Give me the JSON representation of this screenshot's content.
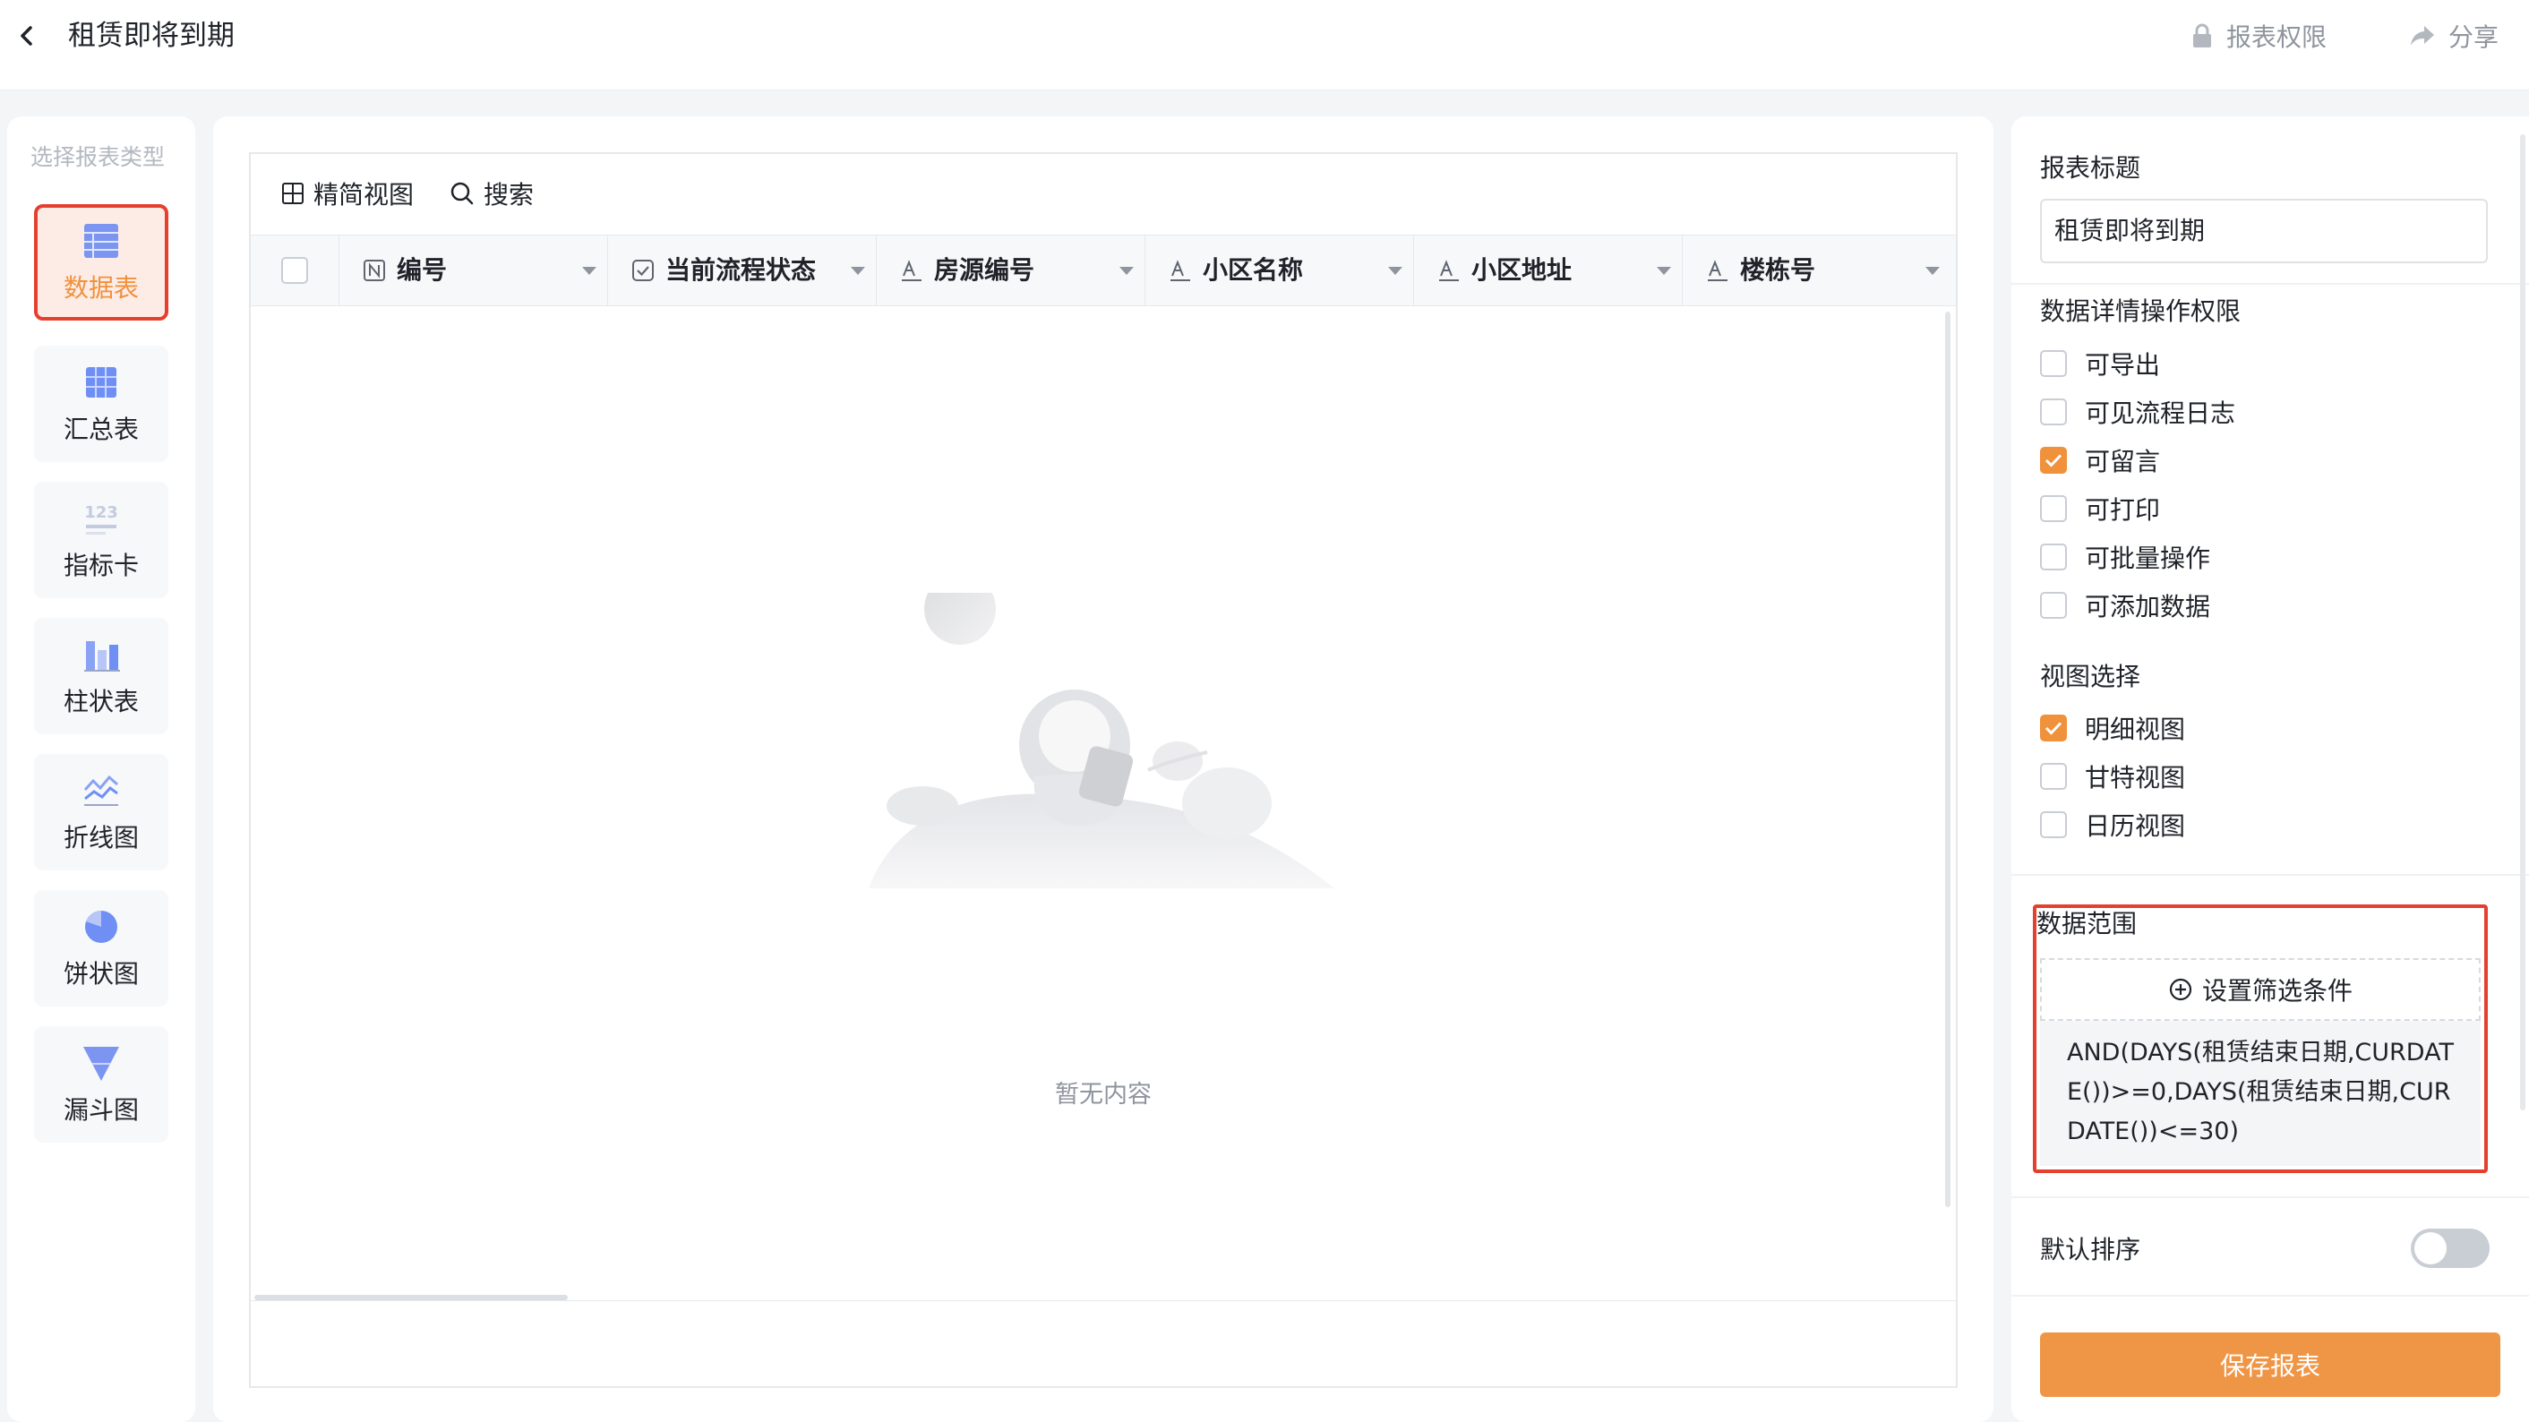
{
  "header": {
    "title": "租赁即将到期",
    "permission_label": "报表权限",
    "share_label": "分享"
  },
  "type_panel": {
    "heading": "选择报表类型",
    "items": [
      {
        "label": "数据表",
        "icon": "table-icon",
        "active": true
      },
      {
        "label": "汇总表",
        "icon": "pivot-table-icon",
        "active": false
      },
      {
        "label": "指标卡",
        "icon": "metric-card-icon",
        "active": false
      },
      {
        "label": "柱状表",
        "icon": "bar-chart-icon",
        "active": false
      },
      {
        "label": "折线图",
        "icon": "line-chart-icon",
        "active": false
      },
      {
        "label": "饼状图",
        "icon": "pie-chart-icon",
        "active": false
      },
      {
        "label": "漏斗图",
        "icon": "funnel-chart-icon",
        "active": false
      }
    ]
  },
  "toolbar": {
    "simple_view_label": "精简视图",
    "search_label": "搜索"
  },
  "table": {
    "columns": [
      {
        "label": "编号",
        "icon": "number-field-icon"
      },
      {
        "label": "当前流程状态",
        "icon": "checkbox-field-icon"
      },
      {
        "label": "房源编号",
        "icon": "text-field-icon"
      },
      {
        "label": "小区名称",
        "icon": "text-field-icon"
      },
      {
        "label": "小区地址",
        "icon": "text-field-icon"
      },
      {
        "label": "楼栋号",
        "icon": "text-field-icon"
      }
    ],
    "empty_text": "暂无内容"
  },
  "settings": {
    "report_title_label": "报表标题",
    "report_title_value": "租赁即将到期",
    "permissions_label": "数据详情操作权限",
    "permissions": [
      {
        "label": "可导出",
        "checked": false
      },
      {
        "label": "可见流程日志",
        "checked": false
      },
      {
        "label": "可留言",
        "checked": true
      },
      {
        "label": "可打印",
        "checked": false
      },
      {
        "label": "可批量操作",
        "checked": false
      },
      {
        "label": "可添加数据",
        "checked": false
      }
    ],
    "view_label": "视图选择",
    "views": [
      {
        "label": "明细视图",
        "checked": true
      },
      {
        "label": "甘特视图",
        "checked": false
      },
      {
        "label": "日历视图",
        "checked": false
      }
    ],
    "range_label": "数据范围",
    "filter_button_label": "设置筛选条件",
    "filter_formula": "AND(DAYS(租赁结束日期,CURDATE())>=0,DAYS(租赁结束日期,CURDATE())<=30)",
    "default_sort_label": "默认排序",
    "default_sort_enabled": false,
    "save_label": "保存报表"
  },
  "colors": {
    "accent": "#f0913c",
    "highlight_border": "#e5402d",
    "icon_blue": "#6f8ff5"
  }
}
